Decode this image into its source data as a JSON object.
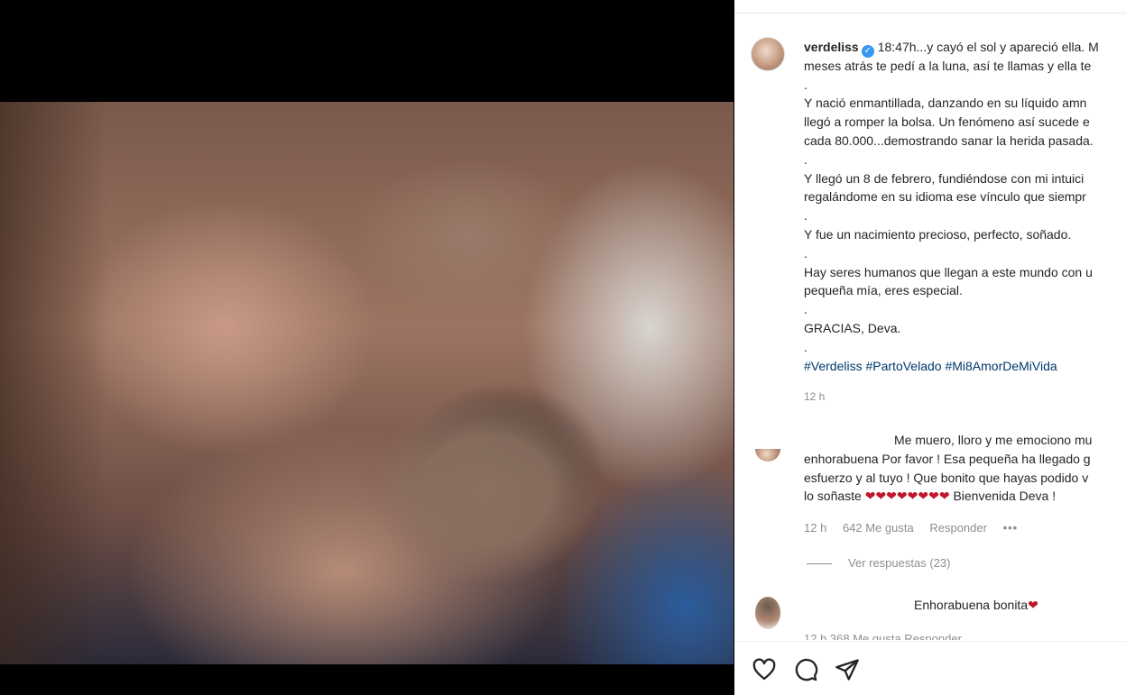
{
  "post": {
    "username": "verdeliss",
    "caption_lines": [
      "18:47h...y cayó el sol y apareció ella. M",
      "meses atrás te pedí a la luna, así te llamas y ella te",
      ".",
      "Y nació enmantillada, danzando en su líquido amn",
      "llegó a romper la bolsa. Un fenómeno así sucede e",
      "cada 80.000...demostrando sanar la herida pasada.",
      ".",
      "Y llegó un 8 de febrero, fundiéndose con mi intuici",
      "regalándome en su idioma ese vínculo que siempr",
      ".",
      "Y fue un nacimiento precioso, perfecto, soñado.",
      ".",
      "Hay seres humanos que llegan a este mundo con u",
      "pequeña mía, eres especial.",
      ".",
      "GRACIAS, Deva.",
      "."
    ],
    "hashtags": "#Verdeliss #PartoVelado #Mi8AmorDeMiVida",
    "time": "12 h"
  },
  "comments": [
    {
      "lines": [
        "Me muero, lloro y me emociono mu",
        "enhorabuena Por favor ! Esa pequeña ha llegado g",
        "esfuerzo y al tuyo ! Que bonito que hayas podido v",
        "lo soñaste"
      ],
      "hearts": "❤❤❤❤❤❤❤❤",
      "ending": " Bienvenida Deva !",
      "time": "12 h",
      "likes": "642 Me gusta",
      "reply": "Responder",
      "more": "•••",
      "view_replies": "Ver respuestas (23)"
    },
    {
      "text": "Enhorabuena bonita",
      "heart": "❤",
      "meta_partial": "12 h    368 Me gusta    Responder"
    }
  ],
  "actions": {
    "like_icon": "heart-outline-icon",
    "comment_icon": "speech-bubble-icon",
    "share_icon": "paper-plane-icon"
  }
}
